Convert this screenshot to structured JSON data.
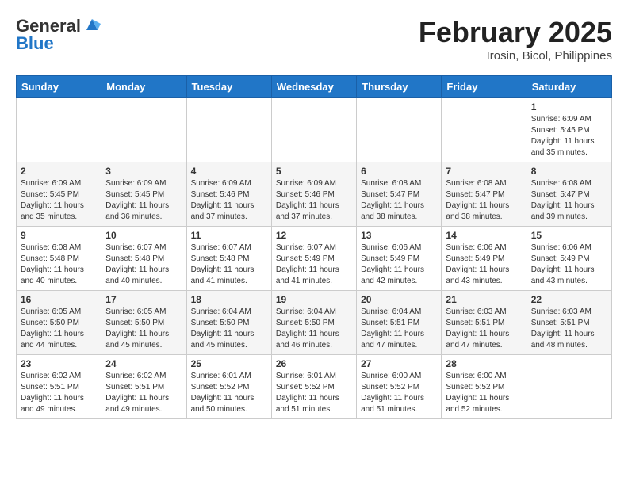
{
  "header": {
    "logo_line1": "General",
    "logo_line2": "Blue",
    "month_year": "February 2025",
    "location": "Irosin, Bicol, Philippines"
  },
  "weekdays": [
    "Sunday",
    "Monday",
    "Tuesday",
    "Wednesday",
    "Thursday",
    "Friday",
    "Saturday"
  ],
  "weeks": [
    [
      {
        "day": "",
        "info": ""
      },
      {
        "day": "",
        "info": ""
      },
      {
        "day": "",
        "info": ""
      },
      {
        "day": "",
        "info": ""
      },
      {
        "day": "",
        "info": ""
      },
      {
        "day": "",
        "info": ""
      },
      {
        "day": "1",
        "info": "Sunrise: 6:09 AM\nSunset: 5:45 PM\nDaylight: 11 hours\nand 35 minutes."
      }
    ],
    [
      {
        "day": "2",
        "info": "Sunrise: 6:09 AM\nSunset: 5:45 PM\nDaylight: 11 hours\nand 35 minutes."
      },
      {
        "day": "3",
        "info": "Sunrise: 6:09 AM\nSunset: 5:45 PM\nDaylight: 11 hours\nand 36 minutes."
      },
      {
        "day": "4",
        "info": "Sunrise: 6:09 AM\nSunset: 5:46 PM\nDaylight: 11 hours\nand 37 minutes."
      },
      {
        "day": "5",
        "info": "Sunrise: 6:09 AM\nSunset: 5:46 PM\nDaylight: 11 hours\nand 37 minutes."
      },
      {
        "day": "6",
        "info": "Sunrise: 6:08 AM\nSunset: 5:47 PM\nDaylight: 11 hours\nand 38 minutes."
      },
      {
        "day": "7",
        "info": "Sunrise: 6:08 AM\nSunset: 5:47 PM\nDaylight: 11 hours\nand 38 minutes."
      },
      {
        "day": "8",
        "info": "Sunrise: 6:08 AM\nSunset: 5:47 PM\nDaylight: 11 hours\nand 39 minutes."
      }
    ],
    [
      {
        "day": "9",
        "info": "Sunrise: 6:08 AM\nSunset: 5:48 PM\nDaylight: 11 hours\nand 40 minutes."
      },
      {
        "day": "10",
        "info": "Sunrise: 6:07 AM\nSunset: 5:48 PM\nDaylight: 11 hours\nand 40 minutes."
      },
      {
        "day": "11",
        "info": "Sunrise: 6:07 AM\nSunset: 5:48 PM\nDaylight: 11 hours\nand 41 minutes."
      },
      {
        "day": "12",
        "info": "Sunrise: 6:07 AM\nSunset: 5:49 PM\nDaylight: 11 hours\nand 41 minutes."
      },
      {
        "day": "13",
        "info": "Sunrise: 6:06 AM\nSunset: 5:49 PM\nDaylight: 11 hours\nand 42 minutes."
      },
      {
        "day": "14",
        "info": "Sunrise: 6:06 AM\nSunset: 5:49 PM\nDaylight: 11 hours\nand 43 minutes."
      },
      {
        "day": "15",
        "info": "Sunrise: 6:06 AM\nSunset: 5:49 PM\nDaylight: 11 hours\nand 43 minutes."
      }
    ],
    [
      {
        "day": "16",
        "info": "Sunrise: 6:05 AM\nSunset: 5:50 PM\nDaylight: 11 hours\nand 44 minutes."
      },
      {
        "day": "17",
        "info": "Sunrise: 6:05 AM\nSunset: 5:50 PM\nDaylight: 11 hours\nand 45 minutes."
      },
      {
        "day": "18",
        "info": "Sunrise: 6:04 AM\nSunset: 5:50 PM\nDaylight: 11 hours\nand 45 minutes."
      },
      {
        "day": "19",
        "info": "Sunrise: 6:04 AM\nSunset: 5:50 PM\nDaylight: 11 hours\nand 46 minutes."
      },
      {
        "day": "20",
        "info": "Sunrise: 6:04 AM\nSunset: 5:51 PM\nDaylight: 11 hours\nand 47 minutes."
      },
      {
        "day": "21",
        "info": "Sunrise: 6:03 AM\nSunset: 5:51 PM\nDaylight: 11 hours\nand 47 minutes."
      },
      {
        "day": "22",
        "info": "Sunrise: 6:03 AM\nSunset: 5:51 PM\nDaylight: 11 hours\nand 48 minutes."
      }
    ],
    [
      {
        "day": "23",
        "info": "Sunrise: 6:02 AM\nSunset: 5:51 PM\nDaylight: 11 hours\nand 49 minutes."
      },
      {
        "day": "24",
        "info": "Sunrise: 6:02 AM\nSunset: 5:51 PM\nDaylight: 11 hours\nand 49 minutes."
      },
      {
        "day": "25",
        "info": "Sunrise: 6:01 AM\nSunset: 5:52 PM\nDaylight: 11 hours\nand 50 minutes."
      },
      {
        "day": "26",
        "info": "Sunrise: 6:01 AM\nSunset: 5:52 PM\nDaylight: 11 hours\nand 51 minutes."
      },
      {
        "day": "27",
        "info": "Sunrise: 6:00 AM\nSunset: 5:52 PM\nDaylight: 11 hours\nand 51 minutes."
      },
      {
        "day": "28",
        "info": "Sunrise: 6:00 AM\nSunset: 5:52 PM\nDaylight: 11 hours\nand 52 minutes."
      },
      {
        "day": "",
        "info": ""
      }
    ]
  ]
}
